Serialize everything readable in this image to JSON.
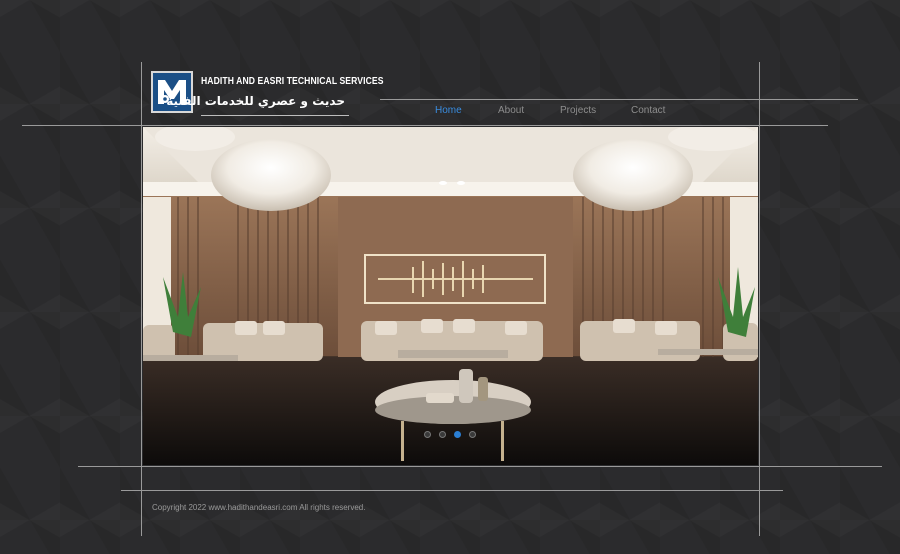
{
  "brand": {
    "name_en": "HADITH AND EASRI TECHNICAL SERVICES",
    "name_ar": "حديث و عصري للخدمات الفنية",
    "logo_letter": "M"
  },
  "nav": {
    "items": [
      {
        "label": "Home",
        "active": true
      },
      {
        "label": "About",
        "active": false
      },
      {
        "label": "Projects",
        "active": false
      },
      {
        "label": "Contact",
        "active": false
      }
    ]
  },
  "slider": {
    "image_alt": "Luxury majlis interior with crystal chandeliers",
    "slide_count": 4,
    "active_index": 2
  },
  "footer": {
    "copyright": "Copyright 2022 www.hadithandeasri.com All rights reserved."
  },
  "colors": {
    "background": "#2b2b2d",
    "accent": "#3a8de0",
    "logo_blue": "#1b4f86"
  }
}
